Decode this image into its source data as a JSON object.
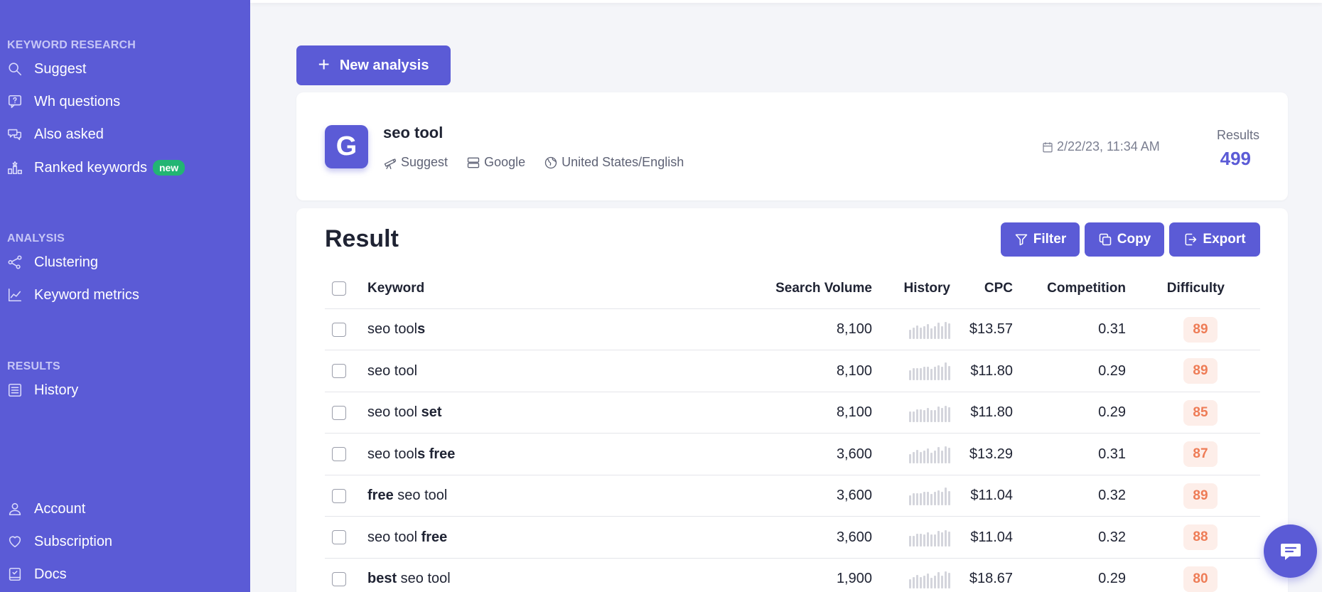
{
  "sidebar": {
    "sections": {
      "keyword_research": "KEYWORD RESEARCH",
      "analysis": "ANALYSIS",
      "results": "RESULTS"
    },
    "items": {
      "suggest": "Suggest",
      "wh_questions": "Wh questions",
      "also_asked": "Also asked",
      "ranked_keywords": "Ranked keywords",
      "ranked_badge": "new",
      "clustering": "Clustering",
      "keyword_metrics": "Keyword metrics",
      "history": "History",
      "account": "Account",
      "subscription": "Subscription",
      "docs": "Docs"
    }
  },
  "actions": {
    "new_analysis": "New analysis"
  },
  "analysis": {
    "logo_letter": "G",
    "title": "seo tool",
    "mode": "Suggest",
    "engine": "Google",
    "locale": "United States/English",
    "date": "2/22/23, 11:34 AM",
    "results_label": "Results",
    "results_value": "499"
  },
  "result": {
    "title": "Result",
    "filter": "Filter",
    "copy": "Copy",
    "export": "Export",
    "columns": {
      "keyword": "Keyword",
      "search_volume": "Search Volume",
      "history": "History",
      "cpc": "CPC",
      "competition": "Competition",
      "difficulty": "Difficulty"
    },
    "rows": [
      {
        "kw_parts": [
          [
            "seo tool",
            false
          ],
          [
            "s",
            true
          ]
        ],
        "volume": "8,100",
        "cpc": "$13.57",
        "competition": "0.31",
        "difficulty": "89"
      },
      {
        "kw_parts": [
          [
            "seo tool",
            false
          ]
        ],
        "volume": "8,100",
        "cpc": "$11.80",
        "competition": "0.29",
        "difficulty": "89"
      },
      {
        "kw_parts": [
          [
            "seo tool ",
            false
          ],
          [
            "set",
            true
          ]
        ],
        "volume": "8,100",
        "cpc": "$11.80",
        "competition": "0.29",
        "difficulty": "85"
      },
      {
        "kw_parts": [
          [
            "seo tool",
            false
          ],
          [
            "s free",
            true
          ]
        ],
        "volume": "3,600",
        "cpc": "$13.29",
        "competition": "0.31",
        "difficulty": "87"
      },
      {
        "kw_parts": [
          [
            "free",
            true
          ],
          [
            " seo tool",
            false
          ]
        ],
        "volume": "3,600",
        "cpc": "$11.04",
        "competition": "0.32",
        "difficulty": "89"
      },
      {
        "kw_parts": [
          [
            "seo tool ",
            false
          ],
          [
            "free",
            true
          ]
        ],
        "volume": "3,600",
        "cpc": "$11.04",
        "competition": "0.32",
        "difficulty": "88"
      },
      {
        "kw_parts": [
          [
            "best",
            true
          ],
          [
            " seo tool",
            false
          ]
        ],
        "volume": "1,900",
        "cpc": "$18.67",
        "competition": "0.29",
        "difficulty": "80"
      }
    ]
  },
  "colors": {
    "accent": "#5b5bd6",
    "difficulty_text": "#ee7c56",
    "difficulty_bg": "#fdeee9",
    "badge_new": "#22b573"
  }
}
